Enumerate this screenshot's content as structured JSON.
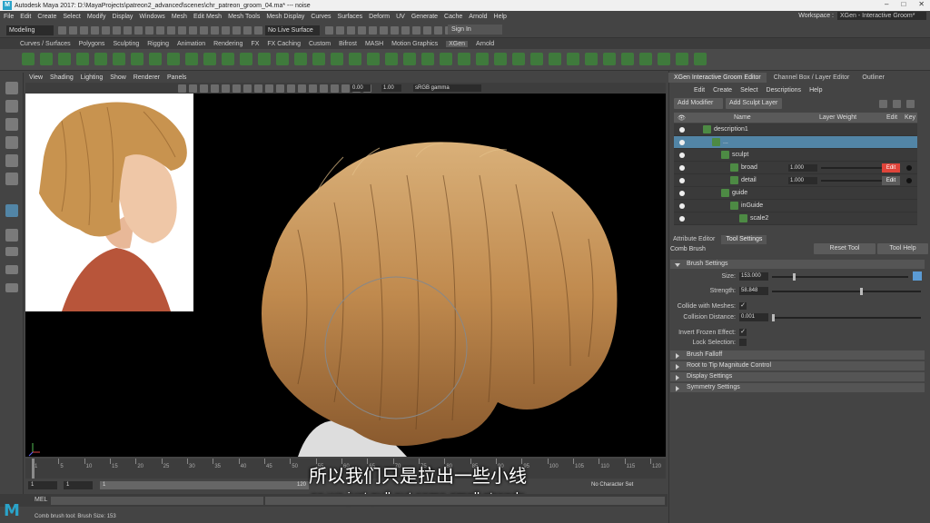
{
  "window": {
    "title": "Autodesk Maya 2017: D:\\MayaProjects\\patreon2_advanced\\scenes\\chr_patreon_groom_04.ma*  ---  noise"
  },
  "menubar": {
    "items": [
      "File",
      "Edit",
      "Create",
      "Select",
      "Modify",
      "Display",
      "Windows",
      "Mesh",
      "Edit Mesh",
      "Mesh Tools",
      "Mesh Display",
      "Curves",
      "Surfaces",
      "Deform",
      "UV",
      "Generate",
      "Cache",
      "Arnold",
      "Help"
    ],
    "workspace_label": "Workspace :",
    "workspace_value": "XGen - Interactive Groom*"
  },
  "status_line": {
    "mode": "Modeling",
    "live_surface": "No Live Surface",
    "sign_in": "Sign In"
  },
  "shelf_tabs": [
    "Curves / Surfaces",
    "Polygons",
    "Sculpting",
    "Rigging",
    "Animation",
    "Rendering",
    "FX",
    "FX Caching",
    "Custom",
    "Bifrost",
    "MASH",
    "Motion Graphics",
    "XGen",
    "Arnold"
  ],
  "shelf_active_tab": "XGen",
  "viewport": {
    "menu": [
      "View",
      "Shading",
      "Lighting",
      "Show",
      "Renderer",
      "Panels"
    ],
    "exposure": "0.00",
    "gamma": "1.00",
    "color_space": "sRGB gamma"
  },
  "timeline": {
    "ticks": [
      "1",
      "5",
      "10",
      "15",
      "20",
      "25",
      "30",
      "35",
      "40",
      "45",
      "50",
      "55",
      "60",
      "65",
      "70",
      "75",
      "80",
      "85",
      "90",
      "95",
      "100",
      "105",
      "110",
      "115",
      "120"
    ],
    "current_frame": "1"
  },
  "range_slider": {
    "start": "1",
    "playback_start": "1",
    "range_left": "1",
    "range_right": "120",
    "no_char_set": "No Character Set"
  },
  "command_line": {
    "label": "MEL"
  },
  "help_line": {
    "text": "Comb brush tool: Brush Size: 153"
  },
  "subtitles": {
    "zh": "所以我们只是拉出一些小线",
    "en": "so we just pull out some small strands"
  },
  "right_panel": {
    "tabs": [
      "XGen Interactive Groom Editor",
      "Channel Box / Layer Editor",
      "Outliner"
    ],
    "menu": [
      "Edit",
      "Create",
      "Select",
      "Descriptions",
      "Help"
    ],
    "add_modifier": "Add Modifier",
    "add_sculpt_layer": "Add Sculpt Layer",
    "columns": {
      "name": "Name",
      "layer_weight": "Layer Weight",
      "edit": "Edit",
      "key": "Key"
    },
    "rows": [
      {
        "label": "description1",
        "indent": 0
      },
      {
        "label": "...",
        "indent": 1
      },
      {
        "label": "sculpt",
        "indent": 2
      },
      {
        "label": "broad",
        "indent": 3,
        "weight": "1.000",
        "edit": "Edit",
        "edit_color": "#e0443a"
      },
      {
        "label": "detail",
        "indent": 3,
        "weight": "1.000",
        "edit": "Edit",
        "edit_color": "#5b5b5b"
      },
      {
        "label": "guide",
        "indent": 2
      },
      {
        "label": "inGuide",
        "indent": 3
      },
      {
        "label": "scale2",
        "indent": 4
      }
    ]
  },
  "attribute_editor": {
    "tabs": [
      "Attribute Editor",
      "Tool Settings"
    ],
    "tool_name": "Comb Brush",
    "reset_tool": "Reset Tool",
    "tool_help": "Tool Help",
    "brush_settings": "Brush Settings",
    "size_label": "Size:",
    "size_value": "153.000",
    "size_level": 0.15,
    "strength_label": "Strength:",
    "strength_value": "58.848",
    "strength_level": 0.59,
    "collide_label": "Collide with Meshes:",
    "collision_distance_label": "Collision Distance:",
    "collision_distance_value": "0.001",
    "invert_frozen_label": "Invert Frozen Effect:",
    "lock_selection_label": "Lock Selection:",
    "check_mark": "✓",
    "sections": [
      "Brush Falloff",
      "Root to Tip Magnitude Control",
      "Display Settings",
      "Symmetry Settings"
    ]
  },
  "colors": {
    "accent_blue": "#5285a6",
    "edit_red": "#e0443a",
    "hair": "#c89a5c"
  }
}
